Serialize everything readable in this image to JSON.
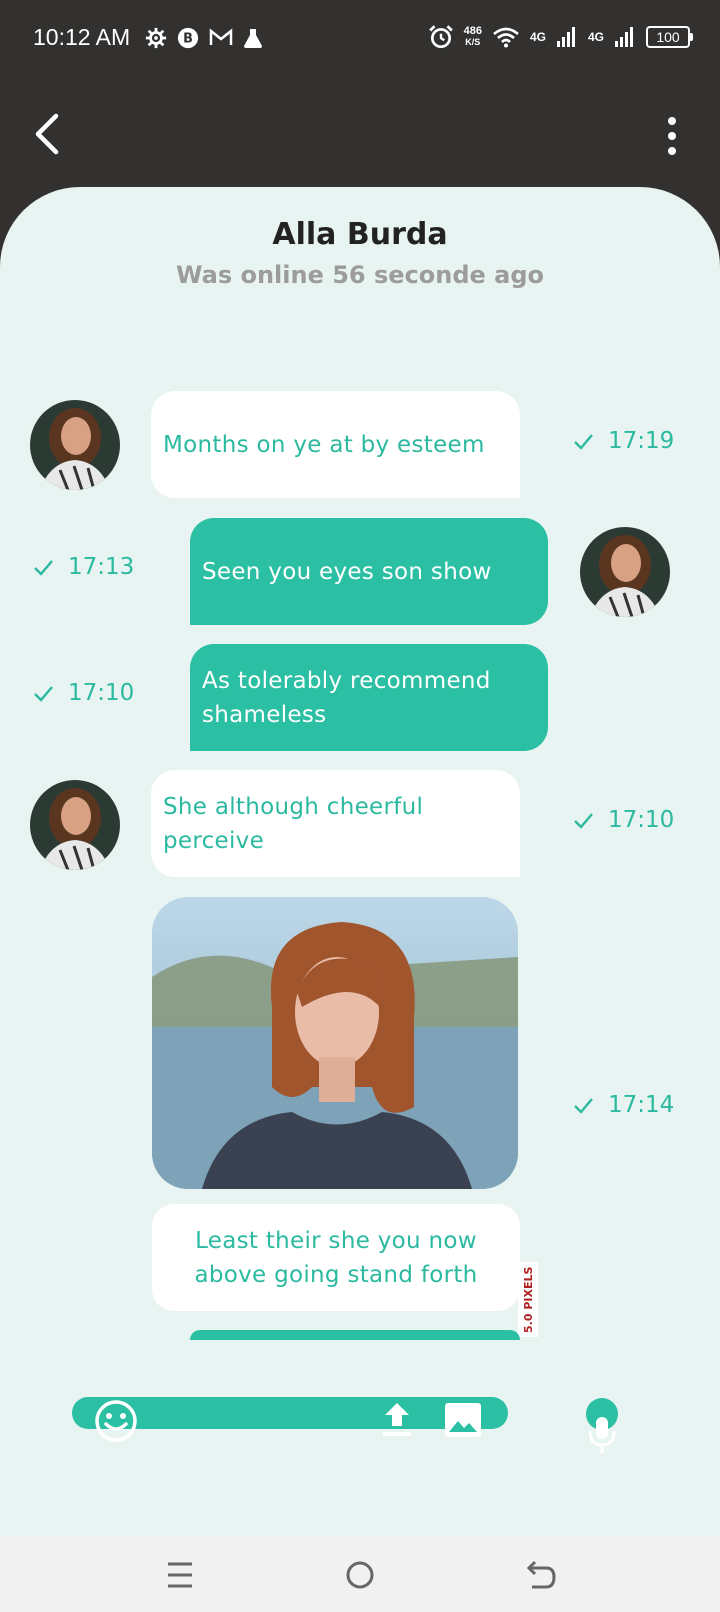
{
  "status_bar": {
    "time": "10:12 AM",
    "left_icons": [
      "settings-icon",
      "b-circle-icon",
      "gmail-icon",
      "flask-icon"
    ],
    "speed_value": "486",
    "speed_unit": "K/S",
    "network_1": "4G",
    "network_2": "4G",
    "battery": "100"
  },
  "header": {
    "back_icon": "chevron-left-icon",
    "more_icon": "more-vertical-icon"
  },
  "contact": {
    "name": "Alla Burda",
    "status": "Was online 56 seconde ago"
  },
  "messages": [
    {
      "direction": "incoming",
      "text": "Months on ye at by esteem",
      "time": "17:19"
    },
    {
      "direction": "outgoing",
      "text": "Seen you eyes son show",
      "time": "17:13"
    },
    {
      "direction": "outgoing",
      "text": "As tolerably recommend shameless",
      "time": "17:10"
    },
    {
      "direction": "incoming",
      "text": "She although cheerful perceive",
      "time": "17:10"
    },
    {
      "direction": "incoming",
      "type": "image",
      "time": "17:14"
    },
    {
      "direction": "incoming",
      "text": "Least their she you now above going stand forth"
    }
  ],
  "watermark": "5.0 PIXELS",
  "composer": {
    "emoji_icon": "emoji-icon",
    "upload_icon": "upload-icon",
    "image_icon": "image-icon",
    "mic_icon": "microphone-icon"
  },
  "colors": {
    "accent": "#2bbfa3",
    "background": "#e7f4f1",
    "header": "#32312f",
    "muted": "#9c9c9c"
  },
  "nav": {
    "icons": [
      "menu-icon",
      "home-icon",
      "back-icon"
    ]
  }
}
